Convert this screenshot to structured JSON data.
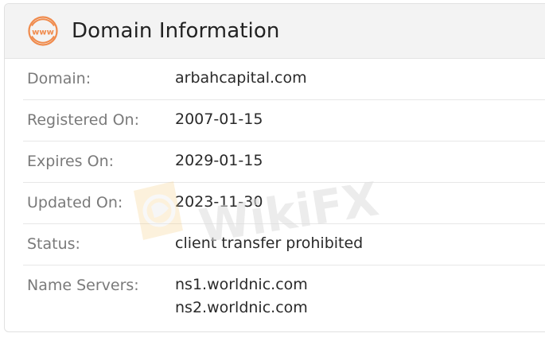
{
  "header": {
    "title": "Domain Information",
    "icon": "www-icon",
    "icon_text": "www",
    "accent_color": "#f08a4b"
  },
  "rows": [
    {
      "label": "Domain:",
      "value": "arbahcapital.com"
    },
    {
      "label": "Registered On:",
      "value": "2007-01-15"
    },
    {
      "label": "Expires On:",
      "value": "2029-01-15"
    },
    {
      "label": "Updated On:",
      "value": "2023-11-30"
    },
    {
      "label": "Status:",
      "value": "client transfer prohibited"
    }
  ],
  "name_servers": {
    "label": "Name Servers:",
    "values": [
      "ns1.worldnic.com",
      "ns2.worldnic.com"
    ]
  },
  "watermark": {
    "text": "WikiFX"
  }
}
